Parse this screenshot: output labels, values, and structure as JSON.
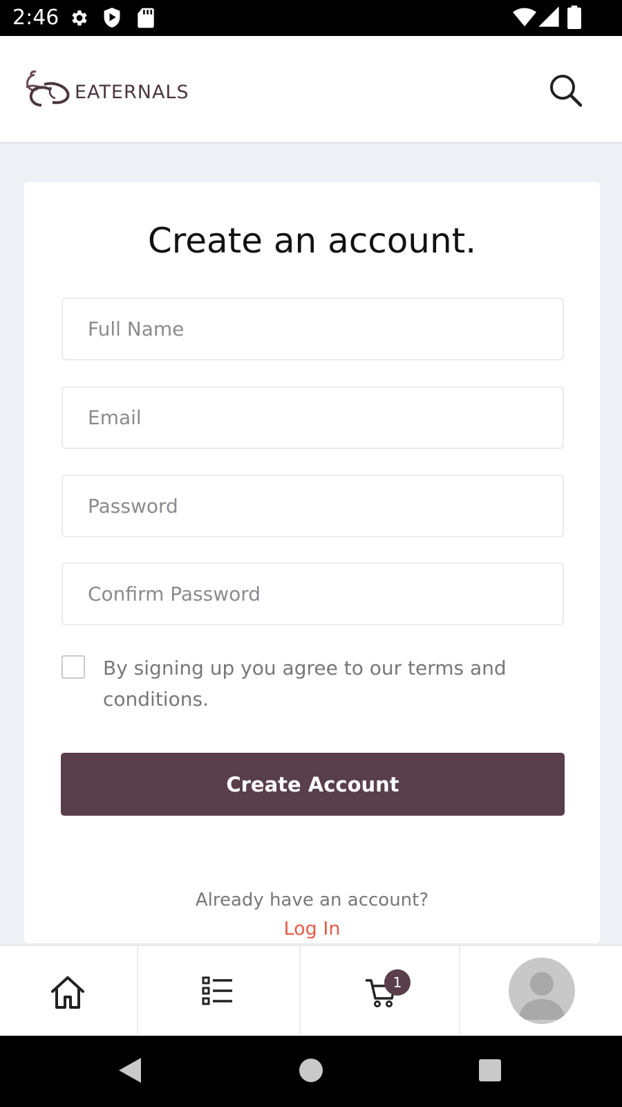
{
  "status_bar": {
    "time": "2:46",
    "icons_left": [
      "gear-icon",
      "shield-play-icon",
      "sd-card-icon"
    ],
    "icons_right": [
      "wifi-icon",
      "signal-icon",
      "battery-icon"
    ]
  },
  "header": {
    "brand": "EATERNALS",
    "brand_color": "#4a3640",
    "search_icon": "search-icon"
  },
  "form": {
    "title": "Create an account.",
    "fields": {
      "full_name": {
        "value": "",
        "placeholder": "Full Name"
      },
      "email": {
        "value": "",
        "placeholder": "Email"
      },
      "password": {
        "value": "",
        "placeholder": "Password"
      },
      "confirm_password": {
        "value": "",
        "placeholder": "Confirm Password"
      }
    },
    "terms": {
      "checked": false,
      "text": "By signing up you agree to our terms and conditions."
    },
    "submit_label": "Create Account",
    "accent_color": "#593e4b"
  },
  "login_prompt": {
    "text": "Already have an account?",
    "link": "Log In",
    "link_color": "#e85a47"
  },
  "bottom_nav": {
    "items": [
      "home-icon",
      "list-icon",
      "cart-icon",
      "avatar"
    ],
    "cart_count": "1"
  },
  "system_nav": [
    "back-icon",
    "home-circle-icon",
    "recents-icon"
  ]
}
